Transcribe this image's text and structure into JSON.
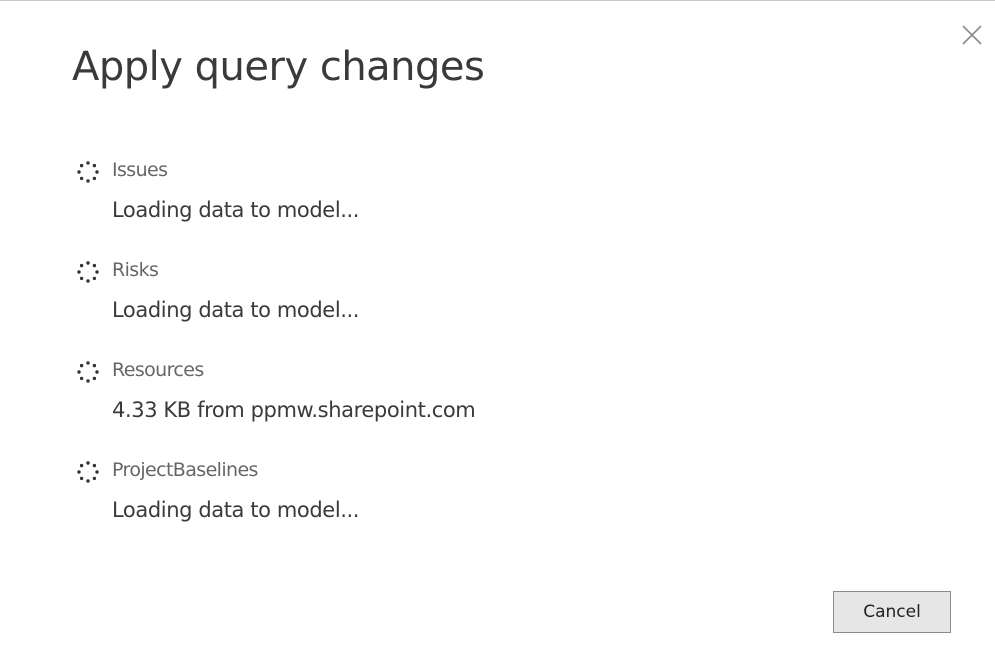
{
  "dialog": {
    "title": "Apply query changes",
    "close_icon": "close-icon",
    "cancel_label": "Cancel"
  },
  "queries": [
    {
      "name": "Issues",
      "status": "Loading data to model...",
      "icon": "loading-spinner-icon"
    },
    {
      "name": "Risks",
      "status": "Loading data to model...",
      "icon": "loading-spinner-icon"
    },
    {
      "name": "Resources",
      "status": "4.33 KB from ppmw.sharepoint.com",
      "icon": "loading-spinner-icon"
    },
    {
      "name": "ProjectBaselines",
      "status": "Loading data to model...",
      "icon": "loading-spinner-icon"
    }
  ],
  "colors": {
    "title": "#3a3a3a",
    "query_name": "#666666",
    "status": "#3a3a3a",
    "button_bg": "#e6e6e6",
    "button_border": "#8a8a8a"
  }
}
